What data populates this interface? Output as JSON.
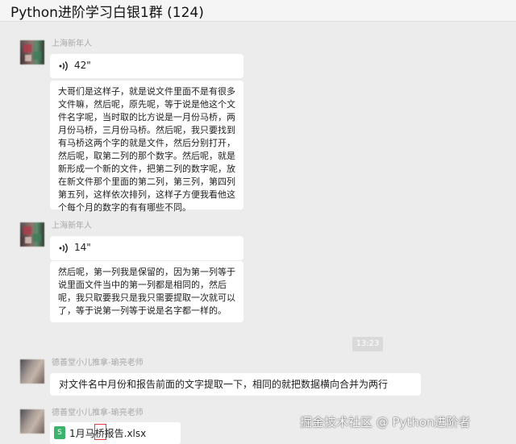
{
  "header": {
    "title": "Python进阶学习白银1群 (124)"
  },
  "messages": [
    {
      "sender": "上海新年人",
      "voice_duration": "42\"",
      "text": "大哥们是这样子，就是说文件里面不是有很多文件嘛，然后呢，原先呢，等于说是他这个文件名字呢，当时取的比方说是一月份马桥，两月份马桥，三月份马桥。然后呢，我只要找到有马桥这两个字的就是文件，然后分别打开，然后呢，取第二列的那个数字。然后呢，就是新形成一个新的文件，把第二列的数字呢，放在新文件那个里面的第二列，第三列，第四列第五列，这样依次排列，这样子方便我看他这个每个月的数字的有有哪些不同。",
      "lines": [
        "大哥们是这样子，就是说文件里面不是有很多",
        "文件嘛，然后呢，原先呢，等于说是他这个文",
        "件名字呢，当时取的比方说是一月份马桥，两",
        "月份马桥，三月份马桥。然后呢，我只要找到",
        "有马桥这两个字的就是文件，然后分别打开，",
        "然后呢，取第二列的那个数字。然后呢，就是",
        "新形成一个新的文件，把第二列的数字呢，放",
        "在新文件那个里面的第二列，第三列，第四列",
        "第五列，这样依次排列，这样子方便我看他这",
        "个每个月的数字的有有哪些不同。"
      ]
    },
    {
      "sender": "上海新年人",
      "voice_duration": "14\"",
      "lines": [
        "然后呢，第一列我是保留的，因为第一列等于",
        "说里面文件当中的第一列都是相同的，然后",
        "呢，我只取要我只是我只需要提取一次就可以",
        "了，等于说第一列等于说是名字都一样的。"
      ]
    },
    {
      "timestamp": "13:23"
    },
    {
      "sender": "德善堂小儿推拿-瑜亮老师",
      "text": "对文件名中月份和报告前面的文字提取一下，相同的就把数据横向合并为两行"
    },
    {
      "sender": "德善堂小儿推拿-瑜亮老师",
      "file_name": "1月马桥报告.xlsx",
      "file_icon_letter": "S"
    }
  ],
  "watermark": "掘金技术社区 @ Python进阶者",
  "colors": {
    "background": "#ececec",
    "bubble": "#ffffff",
    "excel_green": "#3db26b",
    "highlight_red": "#e23b3b"
  }
}
